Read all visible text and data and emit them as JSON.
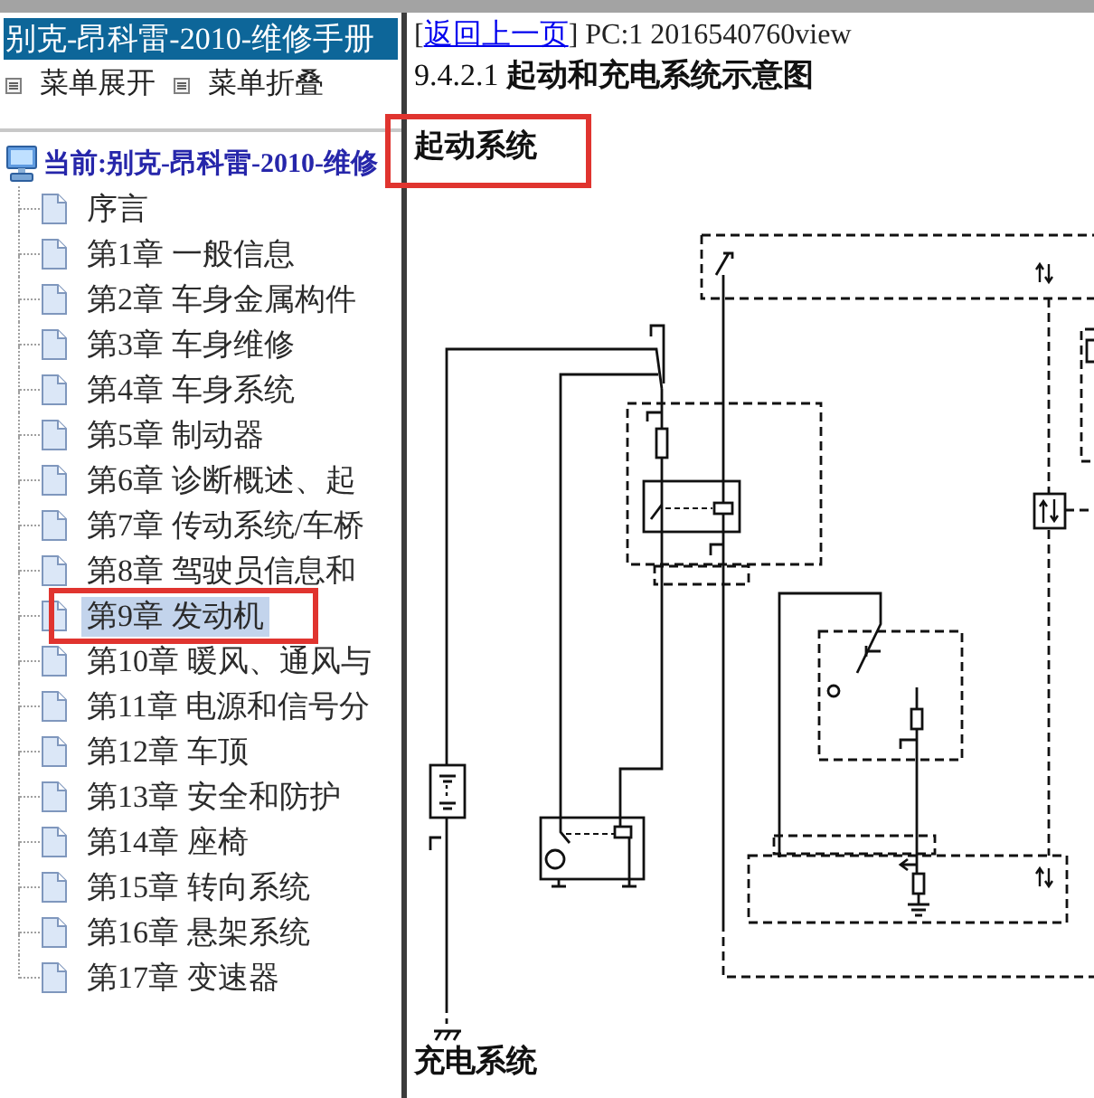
{
  "sidebar": {
    "title": "别克-昂科雷-2010-维修手册",
    "menu": [
      {
        "label": "菜单展开"
      },
      {
        "label": "菜单折叠"
      }
    ],
    "tree": {
      "label": "当前:别克-昂科雷-2010-维修",
      "children": [
        {
          "label": "序言",
          "selected": false,
          "highlighted": false
        },
        {
          "label": "第1章 一般信息",
          "selected": false,
          "highlighted": false
        },
        {
          "label": "第2章 车身金属构件",
          "selected": false,
          "highlighted": false
        },
        {
          "label": "第3章 车身维修",
          "selected": false,
          "highlighted": false
        },
        {
          "label": "第4章 车身系统",
          "selected": false,
          "highlighted": false
        },
        {
          "label": "第5章 制动器",
          "selected": false,
          "highlighted": false
        },
        {
          "label": "第6章 诊断概述、起",
          "selected": false,
          "highlighted": false
        },
        {
          "label": "第7章 传动系统/车桥",
          "selected": false,
          "highlighted": false
        },
        {
          "label": "第8章 驾驶员信息和",
          "selected": false,
          "highlighted": false
        },
        {
          "label": "第9章 发动机",
          "selected": true,
          "highlighted": true
        },
        {
          "label": "第10章 暖风、通风与",
          "selected": false,
          "highlighted": false
        },
        {
          "label": "第11章 电源和信号分",
          "selected": false,
          "highlighted": false
        },
        {
          "label": "第12章 车顶",
          "selected": false,
          "highlighted": false
        },
        {
          "label": "第13章 安全和防护",
          "selected": false,
          "highlighted": false
        },
        {
          "label": "第14章 座椅",
          "selected": false,
          "highlighted": false
        },
        {
          "label": "第15章 转向系统",
          "selected": false,
          "highlighted": false
        },
        {
          "label": "第16章 悬架系统",
          "selected": false,
          "highlighted": false
        },
        {
          "label": "第17章 变速器",
          "selected": false,
          "highlighted": false
        }
      ]
    }
  },
  "content": {
    "nav": {
      "prefix": "[",
      "link": "返回上一页",
      "suffix": "] PC:1 2016540760view"
    },
    "section_title": "9.4.2.1 **起动和充电系统示意图**",
    "blocks": [
      {
        "kind": "heading",
        "text": "起动系统",
        "highlighted": true
      },
      {
        "kind": "diagram"
      },
      {
        "kind": "heading",
        "text": "充电系统",
        "highlighted": false
      }
    ]
  }
}
